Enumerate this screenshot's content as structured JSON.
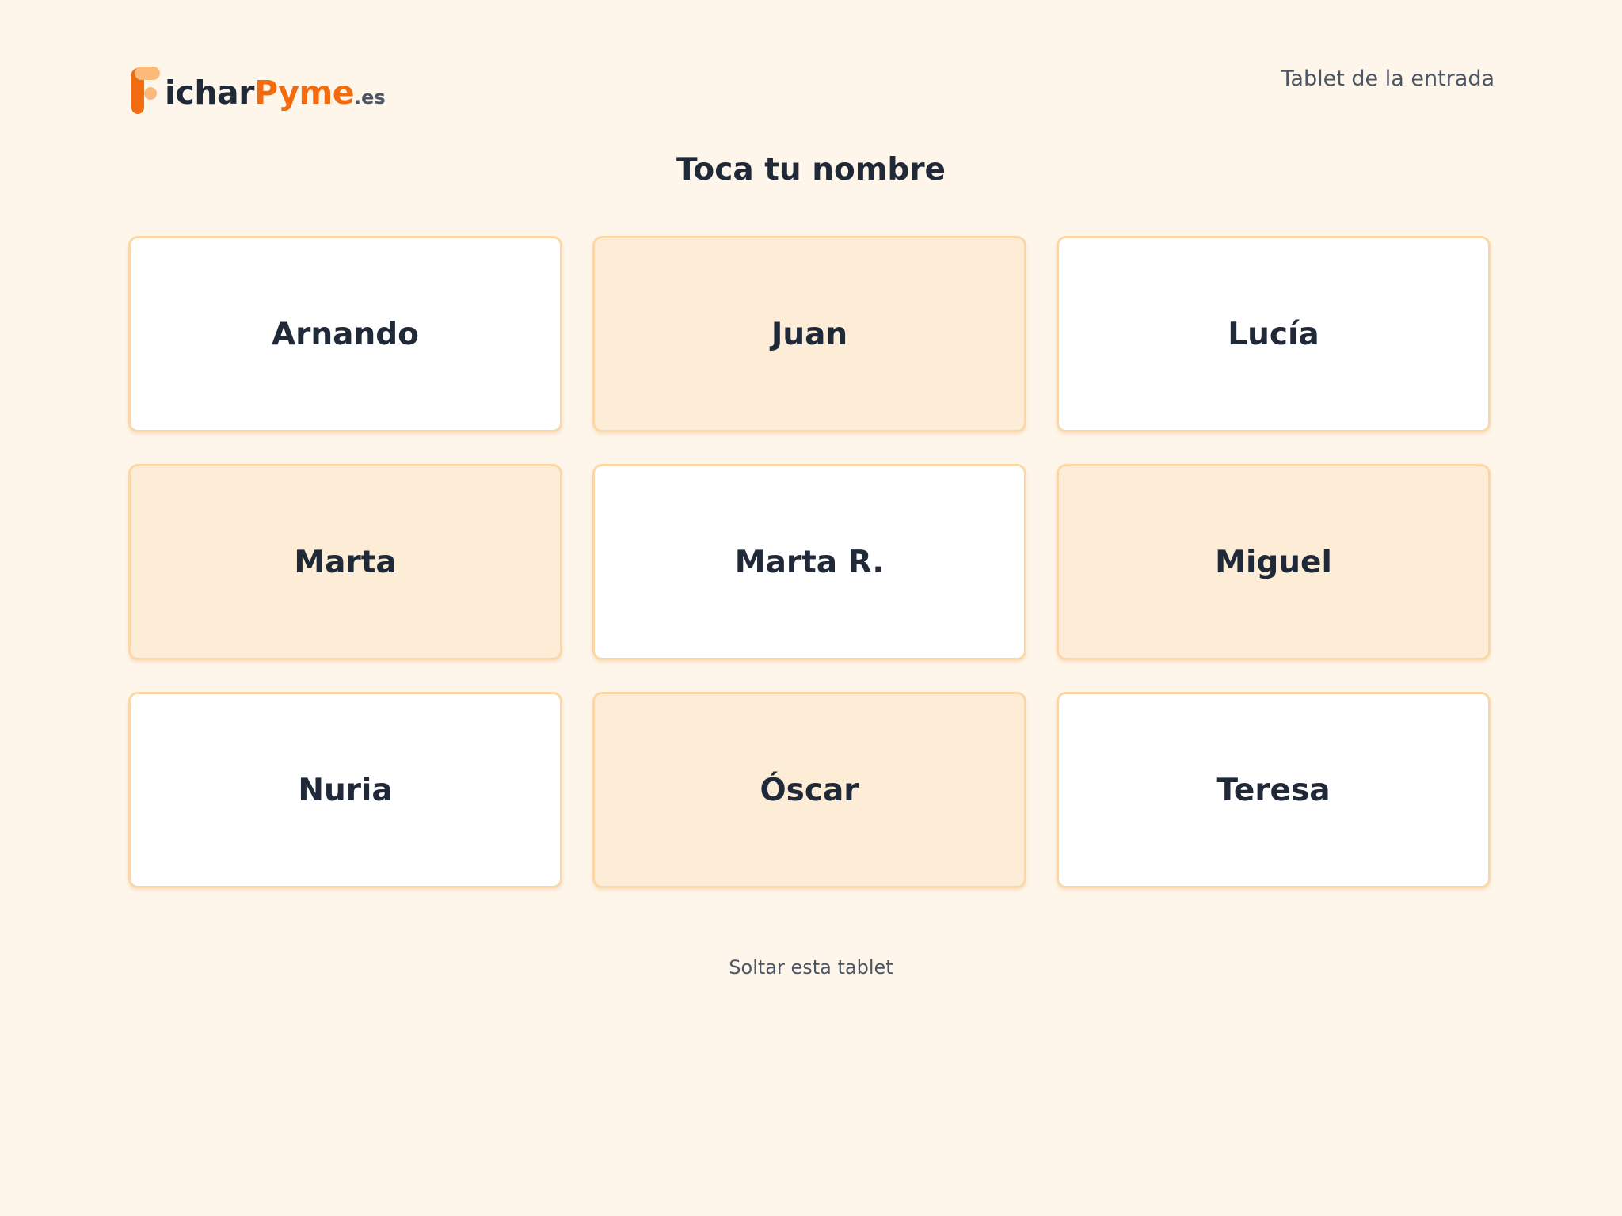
{
  "header": {
    "logo": {
      "part1": "icharPyme",
      "part2": ".es",
      "initial": "F"
    },
    "device_name": "Tablet de la entrada"
  },
  "main": {
    "title": "Toca tu nombre",
    "employees": [
      {
        "name": "Arnando",
        "highlighted": false
      },
      {
        "name": "Juan",
        "highlighted": true
      },
      {
        "name": "Lucía",
        "highlighted": false
      },
      {
        "name": "Marta",
        "highlighted": true
      },
      {
        "name": "Marta R.",
        "highlighted": false
      },
      {
        "name": "Miguel",
        "highlighted": true
      },
      {
        "name": "Nuria",
        "highlighted": false
      },
      {
        "name": "Óscar",
        "highlighted": true
      },
      {
        "name": "Teresa",
        "highlighted": false
      }
    ]
  },
  "footer": {
    "release_label": "Soltar esta tablet"
  },
  "colors": {
    "background": "#fef6ea",
    "accent": "#f26b0f",
    "accent_light": "#fbb97a",
    "card": "#ffffff",
    "card_alt": "#feedd6",
    "card_border": "#fbd7a8",
    "text": "#1f2937",
    "muted": "#4b5563"
  }
}
